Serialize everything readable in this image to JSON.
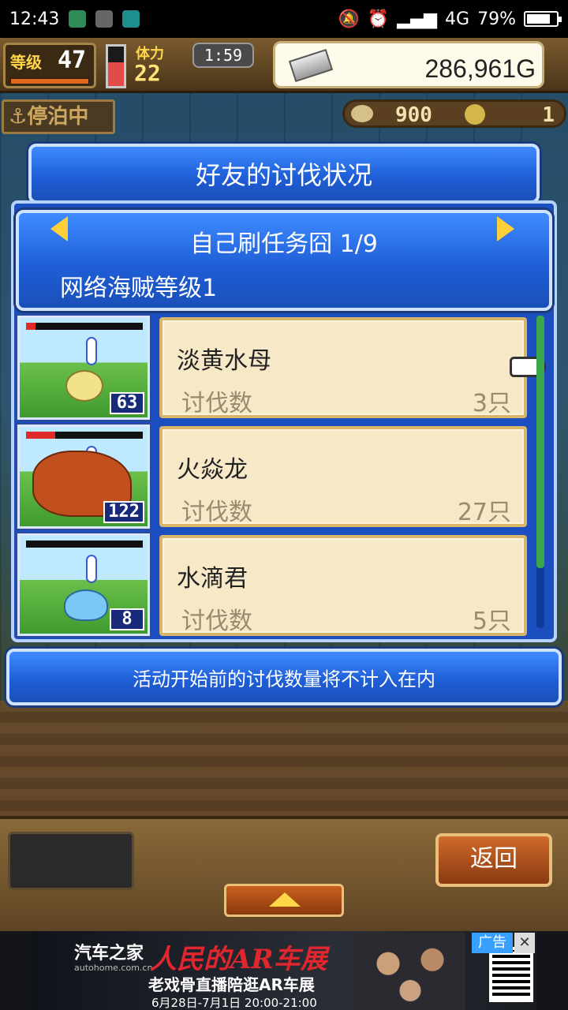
{
  "status_bar": {
    "time": "12:43",
    "network": "4G",
    "battery": "79%"
  },
  "hud": {
    "level_label": "等级",
    "level_value": "47",
    "stamina_label": "体力",
    "stamina_value": "22",
    "timer": "1:59",
    "gold": "286,961G",
    "docked_label": "停泊中",
    "resource_1": "900",
    "resource_2": "1"
  },
  "dialog": {
    "title": "好友的讨伐状况",
    "friend_name": "自己刷任务囧 1/9",
    "friend_rank": "网络海贼等级1",
    "monsters": [
      {
        "name": "淡黄水母",
        "level": "63",
        "label": "讨伐数",
        "count": "3只",
        "hp": 0.08
      },
      {
        "name": "火焱龙",
        "level": "122",
        "label": "讨伐数",
        "count": "27只",
        "hp": 0.25
      },
      {
        "name": "水滴君",
        "level": "8",
        "label": "讨伐数",
        "count": "5只",
        "hp": 0.0
      }
    ],
    "notice": "活动开始前的讨伐数量将不计入在内"
  },
  "footer": {
    "back_label": "返回"
  },
  "ad": {
    "brand": "汽车之家",
    "brand_sub": "autohome.com.cn",
    "headline": "人民的AR车展",
    "subline": "老戏骨直播陪逛AR车展",
    "date": "6月28日-7月1日 20:00-21:00",
    "tag": "广告",
    "close": "✕"
  },
  "colors": {
    "dialog_blue": "#1f5fd8",
    "card_cream": "#f7e8c8",
    "arrow_yellow": "#ffcf3a",
    "hp_red": "#e02a2a"
  }
}
